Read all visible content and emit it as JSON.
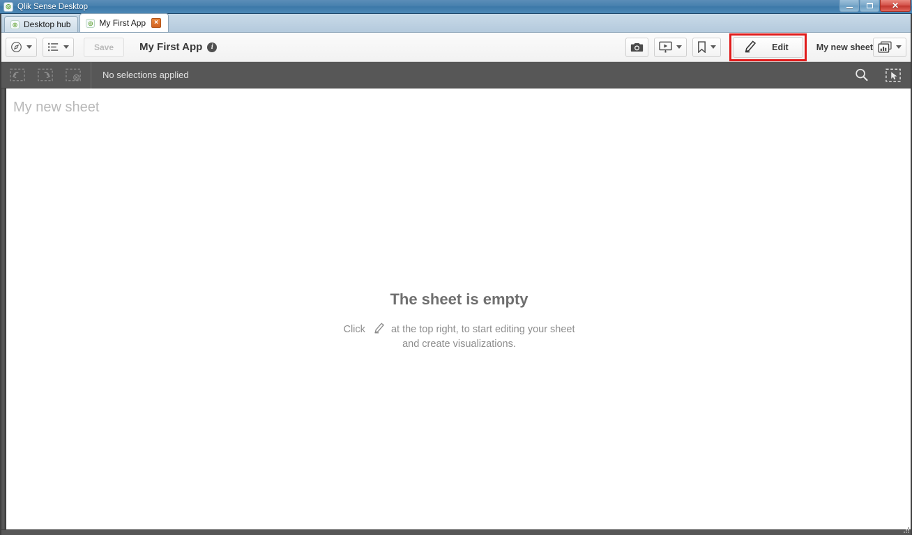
{
  "window": {
    "title": "Qlik Sense Desktop",
    "app_icon": "qlik-logo-icon",
    "minimize_label": "Minimize",
    "maximize_label": "Restore",
    "close_label": "Close"
  },
  "tabs": [
    {
      "label": "Desktop hub",
      "icon": "qlik-logo-icon",
      "active": false,
      "closable": false
    },
    {
      "label": "My First App",
      "icon": "qlik-logo-icon",
      "active": true,
      "closable": true,
      "close_label": "×"
    }
  ],
  "toolbar": {
    "nav_icon": "compass-navigation-icon",
    "sheets_list_icon": "app-overview-list-icon",
    "save_label": "Save",
    "save_enabled": false,
    "app_title": "My First App",
    "info_icon": "info-icon",
    "info_glyph": "i",
    "snapshot_icon": "camera-snapshot-icon",
    "story_icon": "story-presentation-icon",
    "bookmark_icon": "bookmark-icon",
    "edit_label": "Edit",
    "edit_icon": "pencil-edit-icon",
    "edit_highlight_color": "#e01b1b",
    "sheet_name": "My new sheet",
    "sheet_selector_icon": "sheet-overview-icon"
  },
  "selections_bar": {
    "step_back_icon": "selection-step-back-icon",
    "step_forward_icon": "selection-step-forward-icon",
    "clear_all_icon": "selection-clear-all-icon",
    "status_text": "No selections applied",
    "search_icon": "smart-search-icon",
    "selections_tool_icon": "selections-tool-icon"
  },
  "sheet": {
    "title": "My new sheet",
    "empty_heading": "The sheet is empty",
    "empty_text_before": "Click",
    "empty_pencil_icon": "pencil-edit-icon",
    "empty_text_after": "at the top right, to start editing your sheet",
    "empty_text_line2": "and create visualizations."
  },
  "colors": {
    "titlebar_blue": "#4781ae",
    "close_red": "#c0342c",
    "selections_bar_gray": "#575757",
    "accent_red_highlight": "#e01b1b",
    "tab_close_orange": "#d2611f",
    "qlik_green": "#6aa83c"
  }
}
